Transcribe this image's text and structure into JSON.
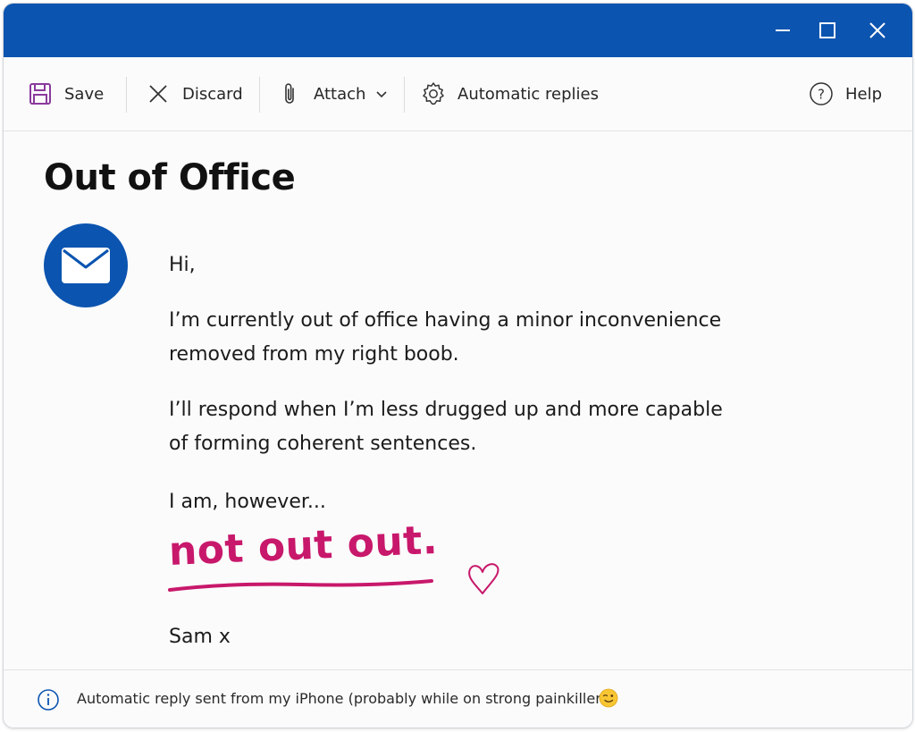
{
  "colors": {
    "accent": "#0b54b0",
    "handwriting": "#c8186b",
    "save_icon": "#8a3a9c"
  },
  "window_controls": {
    "minimize": "minimize-icon",
    "maximize": "maximize-icon",
    "close": "close-icon"
  },
  "toolbar": {
    "save_label": "Save",
    "discard_label": "Discard",
    "attach_label": "Attach",
    "automatic_replies_label": "Automatic replies",
    "help_label": "Help"
  },
  "message": {
    "title": "Out of Office",
    "greeting": "Hi,",
    "paragraph1_line1": "I’m currently out of office having a minor inconvenience",
    "paragraph1_line2": "removed from my right boob.",
    "paragraph2_line1": "I’ll respond when I’m less drugged up and more capable",
    "paragraph2_line2": "of forming coherent sentences.",
    "paragraph3": "I am, however...",
    "handwritten": "not out out.",
    "signature": "Sam x"
  },
  "footer": {
    "text": "Automatic reply sent from my iPhone (probably while on strong painkillers)",
    "emoji": "winking-face"
  }
}
